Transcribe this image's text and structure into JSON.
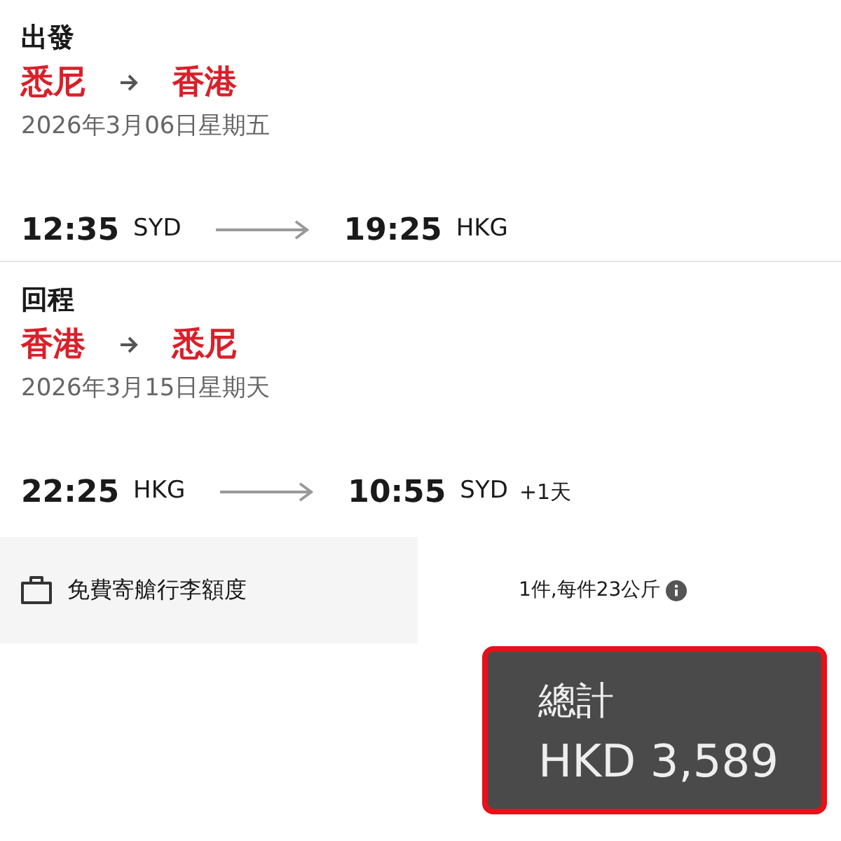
{
  "segments": [
    {
      "heading": "出發",
      "from": "悉尼",
      "to": "香港",
      "date": "2026年3月06日星期五",
      "depart_time": "12:35",
      "depart_code": "SYD",
      "arrive_time": "19:25",
      "arrive_code": "HKG"
    },
    {
      "heading": "回程",
      "from": "香港",
      "to": "悉尼",
      "date": "2026年3月15日星期天",
      "depart_time": "22:25",
      "depart_code": "HKG",
      "arrive_time": "10:55",
      "arrive_code": "SYD",
      "day_offset": "+1天"
    }
  ],
  "baggage": {
    "label": "免費寄艙行李額度",
    "allowance": "1件,每件23公斤"
  },
  "total": {
    "label": "總計",
    "amount": "HKD 3,589"
  }
}
